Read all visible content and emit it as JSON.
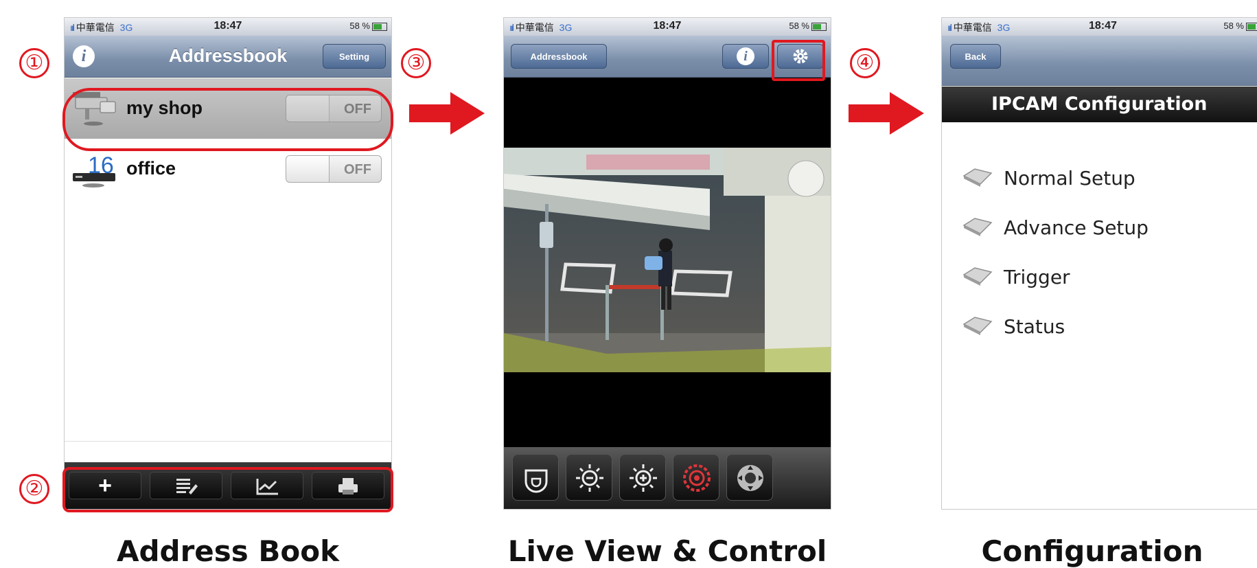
{
  "status_bar": {
    "signal": "ııl",
    "carrier": "中華電信",
    "network": "3G",
    "time": "18:47",
    "battery": "58 %"
  },
  "panel1": {
    "title": "Addressbook",
    "setting_button": "Setting",
    "info_icon": "i",
    "devices": [
      {
        "name": "my shop",
        "toggle": "OFF",
        "icon": "security-camera-icon",
        "selected": true
      },
      {
        "name": "office",
        "toggle": "OFF",
        "icon": "dvr-16-icon",
        "icon_badge": "16",
        "selected": false
      }
    ],
    "toolbar": [
      "add-icon",
      "list-edit-icon",
      "chart-icon",
      "print-icon"
    ],
    "toolbar_add_glyph": "+",
    "caption": "Address Book"
  },
  "panel2": {
    "back_button": "Addressbook",
    "info_icon": "i",
    "settings_icon": "gear-icon",
    "controls": [
      "dome-camera-icon",
      "brightness-minus-icon",
      "brightness-plus-icon",
      "record-icon",
      "ptz-icon"
    ],
    "caption": "Live View & Control"
  },
  "panel3": {
    "back_button": "Back",
    "header": "IPCAM Configuration",
    "menu": [
      "Normal Setup",
      "Advance Setup",
      "Trigger",
      "Status"
    ],
    "caption": "Configuration"
  },
  "callouts": [
    "①",
    "②",
    "③",
    "④"
  ],
  "colors": {
    "accent_red": "#e01820",
    "navbar_blue": "#7a8ea9",
    "highlight_gray": "#b0b0b0"
  }
}
